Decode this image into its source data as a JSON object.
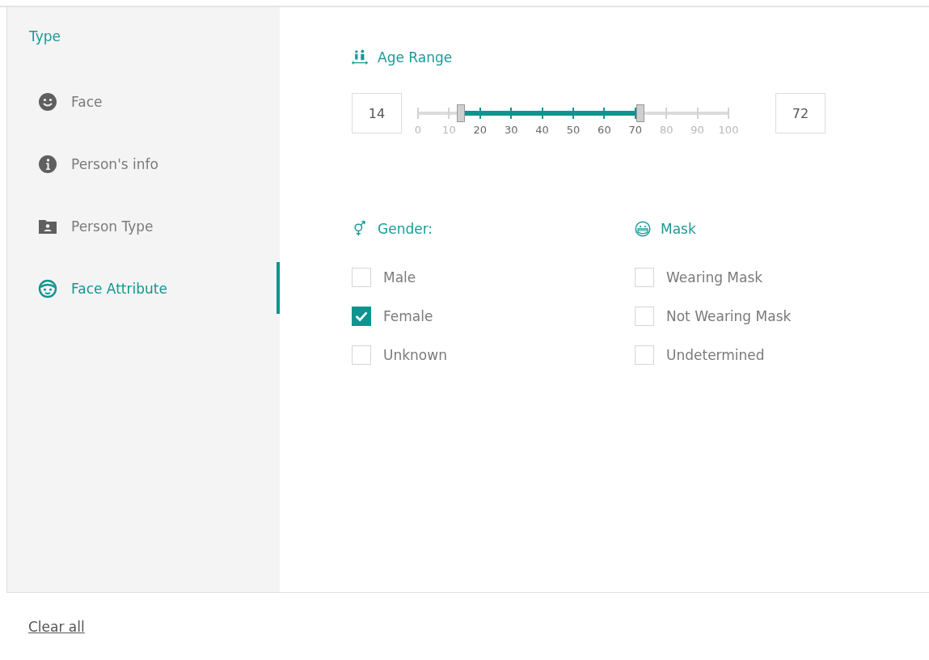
{
  "sidebar": {
    "title": "Type",
    "items": [
      {
        "label": "Face",
        "kind": "face",
        "selected": false
      },
      {
        "label": "Person's info",
        "kind": "info",
        "selected": false
      },
      {
        "label": "Person Type",
        "kind": "person-folder",
        "selected": false
      },
      {
        "label": "Face Attribute",
        "kind": "face-attribute",
        "selected": true
      }
    ]
  },
  "age_range": {
    "title": "Age Range",
    "min_value": "14",
    "max_value": "72",
    "thumbs": [
      {
        "level": 0.14
      },
      {
        "level": 0.72
      }
    ],
    "tick_labels": [
      "0",
      "10",
      "20",
      "30",
      "40",
      "50",
      "60",
      "70",
      "80",
      "90",
      "100"
    ]
  },
  "groups": [
    {
      "title": "Gender:",
      "kind": "gender",
      "options": [
        {
          "label": "Male",
          "checked": false
        },
        {
          "label": "Female",
          "checked": true
        },
        {
          "label": "Unknown",
          "checked": false
        }
      ]
    },
    {
      "title": "Mask",
      "kind": "mask",
      "options": [
        {
          "label": "Wearing Mask",
          "checked": false
        },
        {
          "label": "Not Wearing Mask",
          "checked": false
        },
        {
          "label": "Undetermined",
          "checked": false
        }
      ]
    }
  ],
  "footer": {
    "clear_label": "Clear all"
  }
}
